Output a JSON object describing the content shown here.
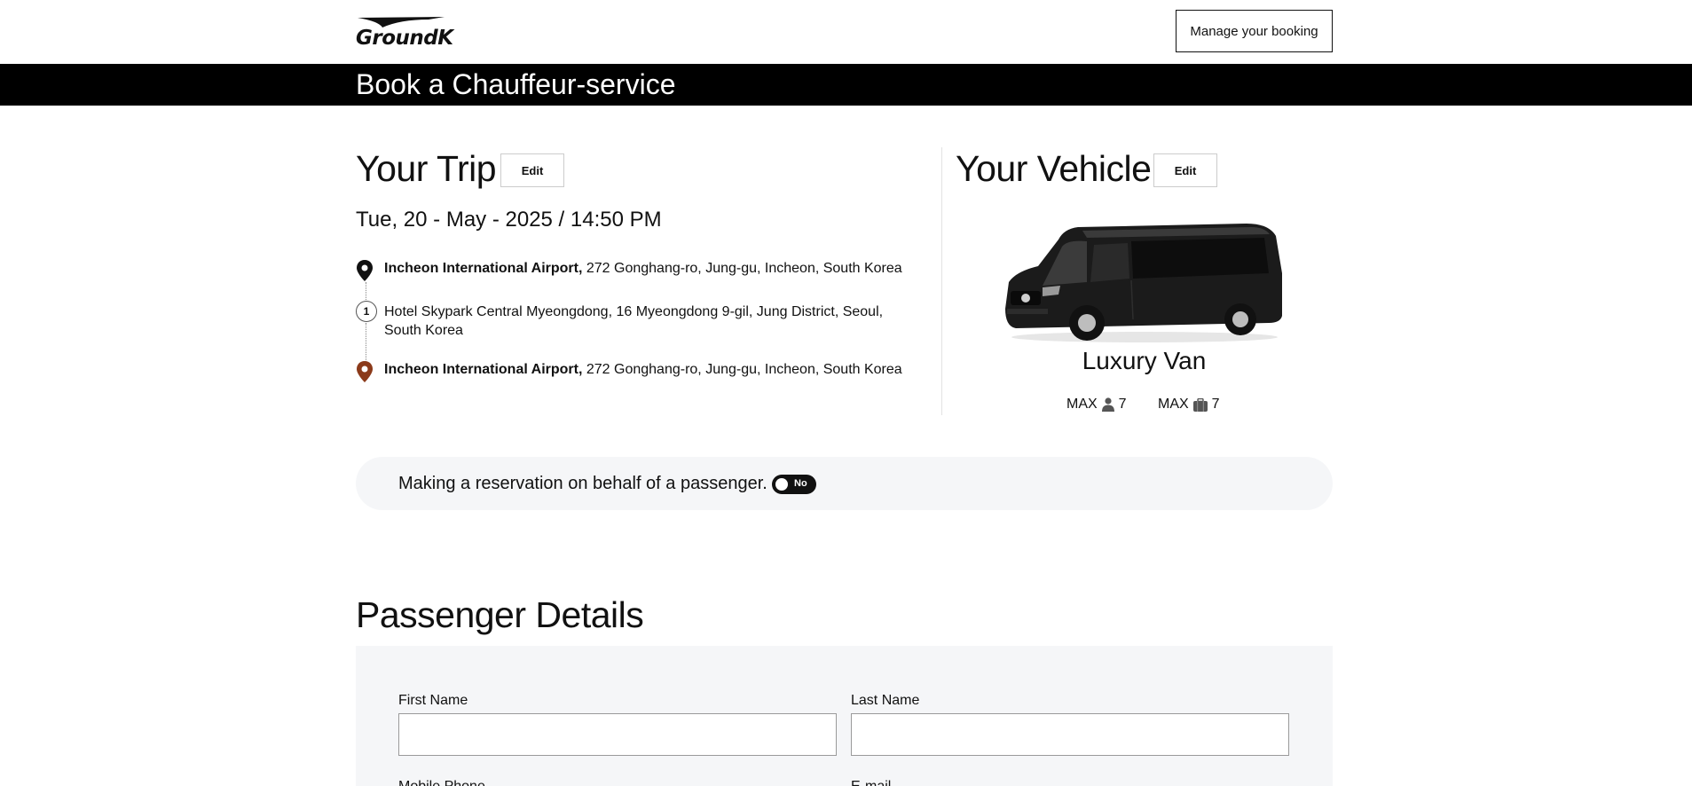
{
  "header": {
    "logo_text": "GroundK",
    "manage_booking_label": "Manage your booking"
  },
  "banner": {
    "title": "Book a Chauffeur-service"
  },
  "trip": {
    "title": "Your Trip",
    "edit_label": "Edit",
    "datetime": "Tue, 20 - May - 2025 / 14:50 PM",
    "pickup": {
      "name": "Incheon International Airport,",
      "address": " 272 Gonghang-ro, Jung-gu, Incheon, South Korea"
    },
    "stop": {
      "number": "1",
      "address": "Hotel Skypark Central Myeongdong, 16 Myeongdong 9-gil, Jung District, Seoul, South Korea"
    },
    "dropoff": {
      "name": "Incheon International Airport,",
      "address": " 272 Gonghang-ro, Jung-gu, Incheon, South Korea"
    }
  },
  "vehicle": {
    "title": "Your Vehicle",
    "edit_label": "Edit",
    "name": "Luxury Van",
    "max_label": "MAX",
    "max_passengers": "7",
    "max_luggage": "7"
  },
  "reservation": {
    "text": "Making a reservation on behalf of a passenger.",
    "toggle_label": "No"
  },
  "passenger": {
    "title": "Passenger Details",
    "first_name_label": "First Name",
    "first_name_value": "",
    "last_name_label": "Last Name",
    "last_name_value": "",
    "mobile_label": "Mobile Phone",
    "email_label": "E-mail"
  },
  "colors": {
    "banner": "#000000",
    "panel": "#f5f6f8",
    "pickup_pin": "#111111",
    "dropoff_pin": "#8b3a1a"
  },
  "icons": {
    "pickup": "map-pin-icon",
    "dropoff": "map-pin-icon",
    "passenger": "person-icon",
    "luggage": "suitcase-icon"
  }
}
